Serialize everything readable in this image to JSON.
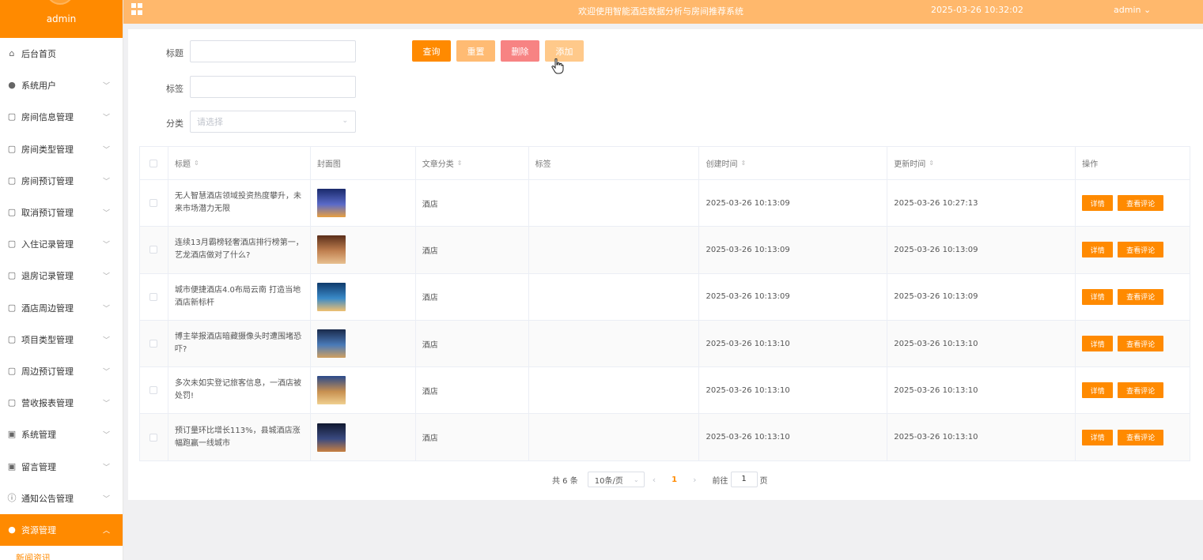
{
  "sidebar": {
    "username": "admin",
    "items": [
      {
        "label": "后台首页",
        "icon": "home-icon",
        "glyph": "⌂",
        "has_children": false
      },
      {
        "label": "系统用户",
        "icon": "user-icon",
        "glyph": "●",
        "has_children": true
      },
      {
        "label": "房间信息管理",
        "icon": "doc-icon",
        "glyph": "▢",
        "has_children": true
      },
      {
        "label": "房间类型管理",
        "icon": "doc-icon",
        "glyph": "▢",
        "has_children": true
      },
      {
        "label": "房间预订管理",
        "icon": "doc-icon",
        "glyph": "▢",
        "has_children": true
      },
      {
        "label": "取消预订管理",
        "icon": "doc-icon",
        "glyph": "▢",
        "has_children": true
      },
      {
        "label": "入住记录管理",
        "icon": "doc-icon",
        "glyph": "▢",
        "has_children": true
      },
      {
        "label": "退房记录管理",
        "icon": "doc-icon",
        "glyph": "▢",
        "has_children": true
      },
      {
        "label": "酒店周边管理",
        "icon": "doc-icon",
        "glyph": "▢",
        "has_children": true
      },
      {
        "label": "项目类型管理",
        "icon": "doc-icon",
        "glyph": "▢",
        "has_children": true
      },
      {
        "label": "周边预订管理",
        "icon": "doc-icon",
        "glyph": "▢",
        "has_children": true
      },
      {
        "label": "营收报表管理",
        "icon": "doc-icon",
        "glyph": "▢",
        "has_children": true
      },
      {
        "label": "系统管理",
        "icon": "image-icon",
        "glyph": "▣",
        "has_children": true
      },
      {
        "label": "留言管理",
        "icon": "image-icon",
        "glyph": "▣",
        "has_children": true
      },
      {
        "label": "通知公告管理",
        "icon": "info-icon",
        "glyph": "ⓘ",
        "has_children": true
      },
      {
        "label": "资源管理",
        "icon": "location-icon",
        "glyph": "●",
        "has_children": true,
        "active": true
      }
    ],
    "submenu": [
      "新闻资讯"
    ]
  },
  "topbar": {
    "welcome": "欢迎使用智能酒店数据分析与房间推荐系统",
    "datetime": "2025-03-26 10:32:02",
    "user": "admin ⌄"
  },
  "search": {
    "title_label": "标题",
    "tag_label": "标签",
    "category_label": "分类",
    "category_placeholder": "请选择",
    "title_value": "",
    "tag_value": ""
  },
  "buttons": {
    "query": "查询",
    "reset": "重置",
    "delete": "删除",
    "add": "添加"
  },
  "table": {
    "headers": {
      "title": "标题",
      "cover": "封面图",
      "category": "文章分类",
      "tags": "标签",
      "created": "创建时间",
      "updated": "更新时间",
      "actions": "操作"
    },
    "rows": [
      {
        "title": "无人智慧酒店领域投资热度攀升，未来市场潜力无限",
        "category": "酒店",
        "tags": "",
        "created": "2025-03-26 10:13:09",
        "updated": "2025-03-26 10:27:13",
        "thumb_colors": [
          "#1a2a6b",
          "#5a6ac8",
          "#e8a040"
        ]
      },
      {
        "title": "连续13月霸榜轻奢酒店排行榜第一，艺龙酒店做对了什么?",
        "category": "酒店",
        "tags": "",
        "created": "2025-03-26 10:13:09",
        "updated": "2025-03-26 10:13:09",
        "thumb_colors": [
          "#5a2e1a",
          "#c08050",
          "#e8c090"
        ]
      },
      {
        "title": "城市便捷酒店4.0布局云南 打造当地酒店新标杆",
        "category": "酒店",
        "tags": "",
        "created": "2025-03-26 10:13:09",
        "updated": "2025-03-26 10:13:09",
        "thumb_colors": [
          "#0f3a6b",
          "#3a8ac8",
          "#f0c070"
        ]
      },
      {
        "title": "博主举报酒店暗藏摄像头时遭围堵恐吓?",
        "category": "酒店",
        "tags": "",
        "created": "2025-03-26 10:13:10",
        "updated": "2025-03-26 10:13:10",
        "thumb_colors": [
          "#1a2a4b",
          "#4a7ab8",
          "#d0a060"
        ]
      },
      {
        "title": "多次未如实登记旅客信息，一酒店被处罚!",
        "category": "酒店",
        "tags": "",
        "created": "2025-03-26 10:13:10",
        "updated": "2025-03-26 10:13:10",
        "thumb_colors": [
          "#2a4a8b",
          "#c89050",
          "#f0d090"
        ]
      },
      {
        "title": "预订量环比增长113%，县城酒店涨幅跑赢一线城市",
        "category": "酒店",
        "tags": "",
        "created": "2025-03-26 10:13:10",
        "updated": "2025-03-26 10:13:10",
        "thumb_colors": [
          "#101830",
          "#3a4a80",
          "#c88040"
        ]
      }
    ],
    "detail_label": "详情",
    "comment_label": "查看评论"
  },
  "pager": {
    "total": "共 6 条",
    "page_size": "10条/页",
    "current": "1",
    "goto_prefix": "前往",
    "goto_value": "1",
    "goto_suffix": "页"
  },
  "colors": {
    "accent": "#ff8a00",
    "topbar": "#ffb86c",
    "delete": "#f78383"
  }
}
